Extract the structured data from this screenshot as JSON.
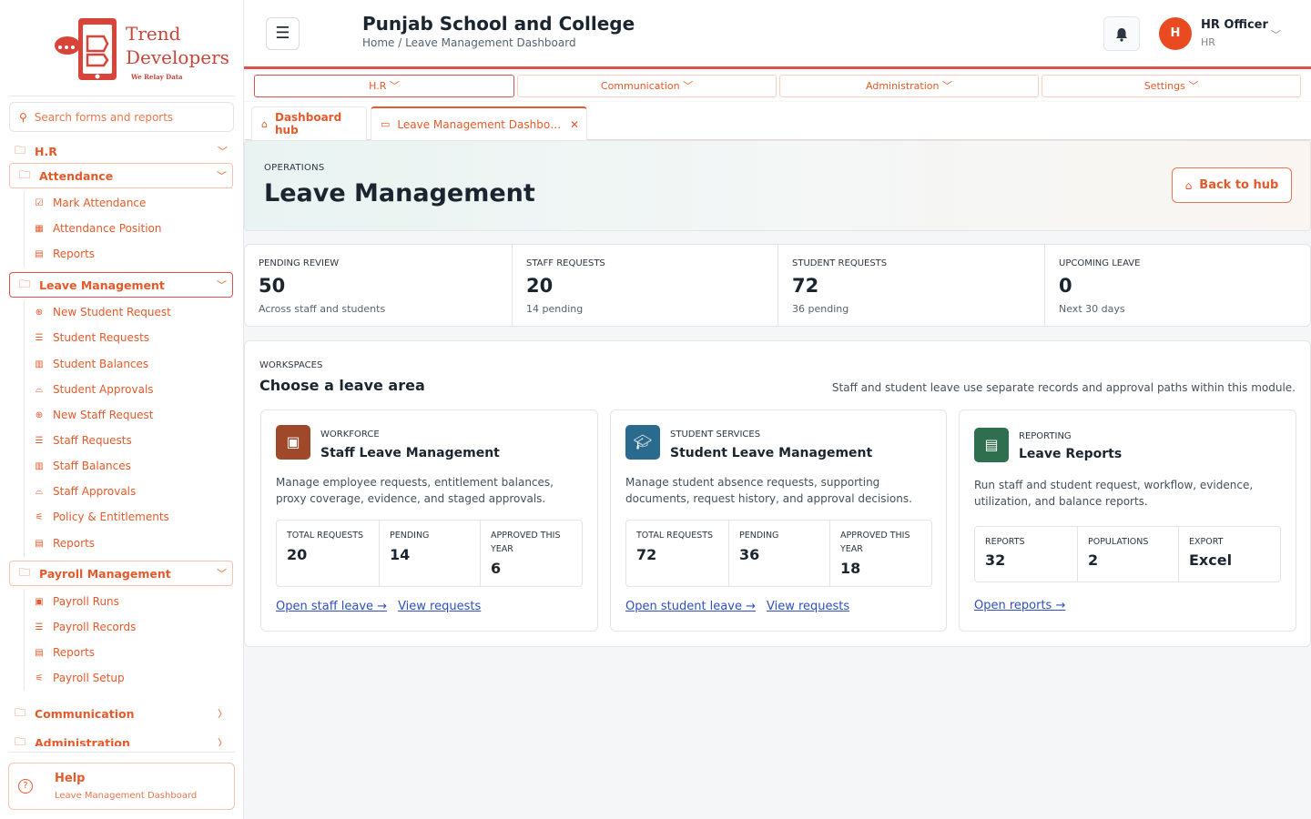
{
  "brand": {
    "name_line1": "Trend",
    "name_line2": "Developers",
    "tagline": "We Relay Data",
    "color": "#e55a2b"
  },
  "search": {
    "placeholder": "Search forms and reports"
  },
  "sidebar": {
    "hr_label": "H.R",
    "attendance": {
      "label": "Attendance",
      "items": [
        "Mark Attendance",
        "Attendance Position",
        "Reports"
      ]
    },
    "leave": {
      "label": "Leave Management",
      "items": [
        "New Student Request",
        "Student Requests",
        "Student Balances",
        "Student Approvals",
        "New Staff Request",
        "Staff Requests",
        "Staff Balances",
        "Staff Approvals",
        "Policy & Entitlements",
        "Reports"
      ]
    },
    "payroll": {
      "label": "Payroll Management",
      "items": [
        "Payroll Runs",
        "Payroll Records",
        "Reports",
        "Payroll Setup"
      ]
    },
    "communication": "Communication",
    "administration": "Administration"
  },
  "help": {
    "title": "Help",
    "subtitle": "Leave Management Dashboard"
  },
  "header": {
    "school": "Punjab School and College",
    "breadcrumb": "Home / Leave Management Dashboard",
    "user_initial": "H",
    "user_name": "HR Officer",
    "user_role": "HR"
  },
  "topmenu": [
    "H.R",
    "Communication",
    "Administration",
    "Settings"
  ],
  "tabs": {
    "hub": "Dashboard hub",
    "active": "Leave Management Dashbo…"
  },
  "hero": {
    "eyebrow": "OPERATIONS",
    "title": "Leave Management",
    "back_label": "Back to hub"
  },
  "stats": [
    {
      "label": "PENDING REVIEW",
      "value": "50",
      "note": "Across staff and students"
    },
    {
      "label": "STAFF REQUESTS",
      "value": "20",
      "note": "14 pending"
    },
    {
      "label": "STUDENT REQUESTS",
      "value": "72",
      "note": "36 pending"
    },
    {
      "label": "UPCOMING LEAVE",
      "value": "0",
      "note": "Next 30 days"
    }
  ],
  "workspaces": {
    "eyebrow": "WORKSPACES",
    "title": "Choose a leave area",
    "description": "Staff and student leave use separate records and approval paths within this module.",
    "cards": [
      {
        "eyebrow": "WORKFORCE",
        "title": "Staff Leave Management",
        "color": "#a0492a",
        "description": "Manage employee requests, entitlement balances, proxy coverage, evidence, and staged approvals.",
        "metrics": [
          {
            "label": "TOTAL REQUESTS",
            "value": "20"
          },
          {
            "label": "PENDING",
            "value": "14"
          },
          {
            "label": "APPROVED THIS YEAR",
            "value": "6"
          }
        ],
        "links": [
          "Open staff leave →",
          "View requests"
        ]
      },
      {
        "eyebrow": "STUDENT SERVICES",
        "title": "Student Leave Management",
        "color": "#2b6a8f",
        "description": "Manage student absence requests, supporting documents, request history, and approval decisions.",
        "metrics": [
          {
            "label": "TOTAL REQUESTS",
            "value": "72"
          },
          {
            "label": "PENDING",
            "value": "36"
          },
          {
            "label": "APPROVED THIS YEAR",
            "value": "18"
          }
        ],
        "links": [
          "Open student leave →",
          "View requests"
        ]
      },
      {
        "eyebrow": "REPORTING",
        "title": "Leave Reports",
        "color": "#2f6f4f",
        "description": "Run staff and student request, workflow, evidence, utilization, and balance reports.",
        "metrics": [
          {
            "label": "REPORTS",
            "value": "32"
          },
          {
            "label": "POPULATIONS",
            "value": "2"
          },
          {
            "label": "EXPORT",
            "value": "Excel"
          }
        ],
        "links": [
          "Open reports →"
        ]
      }
    ]
  }
}
